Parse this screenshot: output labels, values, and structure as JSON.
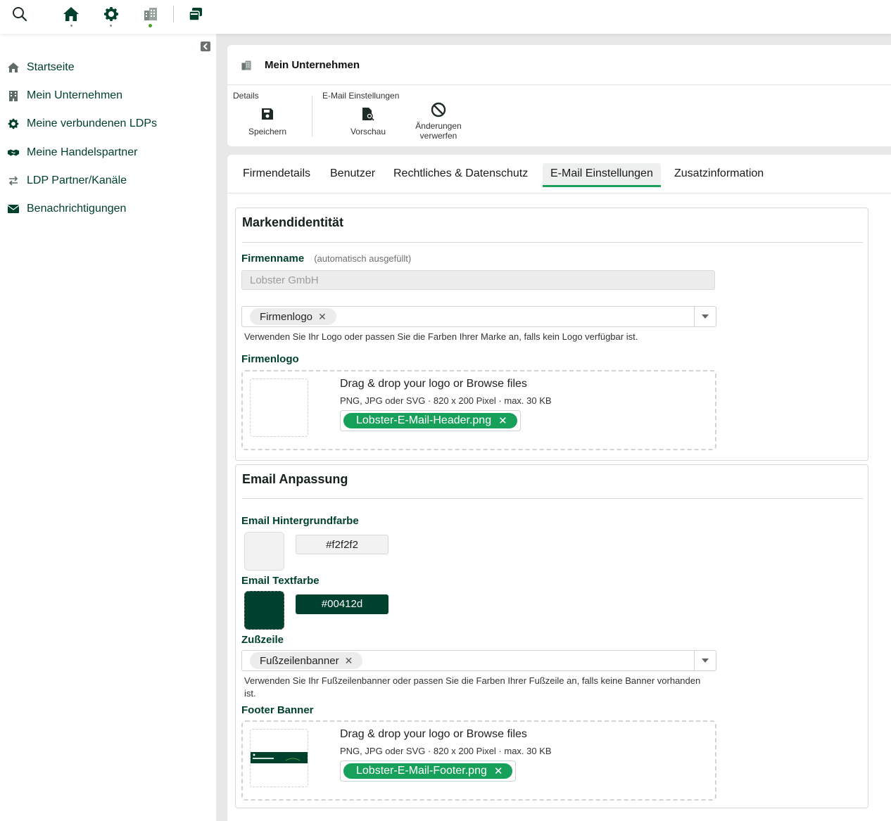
{
  "colors": {
    "brand": "#00412d",
    "accent": "#17a05a"
  },
  "topbar": {
    "icons": [
      "search-icon",
      "home-icon",
      "gear-icon",
      "building-icon",
      "windows-stack-icon"
    ]
  },
  "sidebar": {
    "items": [
      {
        "label": "Startseite",
        "icon": "home-icon"
      },
      {
        "label": "Mein Unternehmen",
        "icon": "building-icon"
      },
      {
        "label": "Meine verbundenen LDPs",
        "icon": "gear-icon"
      },
      {
        "label": "Meine Handelspartner",
        "icon": "handshake-icon"
      },
      {
        "label": "LDP Partner/Kanäle",
        "icon": "arrows-exchange-icon"
      },
      {
        "label": "Benachrichtigungen",
        "icon": "envelope-icon"
      }
    ]
  },
  "header": {
    "title": "Mein Unternehmen",
    "groups": [
      {
        "label": "Details",
        "tools": [
          {
            "label": "Speichern"
          }
        ]
      },
      {
        "label": "E-Mail Einstellungen",
        "tools": [
          {
            "label": "Vorschau"
          },
          {
            "label": "Änderungen",
            "label2": "verwerfen"
          }
        ]
      }
    ]
  },
  "tabs": [
    "Firmendetails",
    "Benutzer",
    "Rechtliches & Datenschutz",
    "E-Mail Einstellungen",
    "Zusatzinformation"
  ],
  "active_tab": "E-Mail Einstellungen",
  "brand_section": {
    "title": "Markendidentität",
    "company_label": "Firmenname",
    "company_hint": "(automatisch ausgefüllt)",
    "company_value": "Lobster GmbH",
    "logo_select_chip": "Firmenlogo",
    "logo_select_desc": "Verwenden Sie Ihr Logo oder passen Sie die Farben Ihrer Marke an, falls kein Logo verfügbar ist.",
    "logo_label": "Firmenlogo",
    "drop_title": "Drag & drop your logo or Browse files",
    "drop_sub": "PNG, JPG oder SVG · 820 x 200 Pixel · max. 30 KB",
    "file": "Lobster-E-Mail-Header.png"
  },
  "email_section": {
    "title": "Email Anpassung",
    "bg_label": "Email Hintergrundfarbe",
    "bg_value": "#f2f2f2",
    "text_label": "Email Textfarbe",
    "text_value": "#00412d",
    "footer_label": "Zußzeile",
    "footer_chip": "Fußzeilenbanner",
    "footer_desc": "Verwenden Sie Ihr Fußzeilenbanner oder passen Sie die Farben Ihrer Fußzeile an, falls keine Banner vorhanden ist.",
    "banner_label": "Footer Banner",
    "drop_title": "Drag & drop your logo or Browse files",
    "drop_sub": "PNG, JPG oder SVG · 820 x 200 Pixel · max. 30 KB",
    "file": "Lobster-E-Mail-Footer.png"
  }
}
